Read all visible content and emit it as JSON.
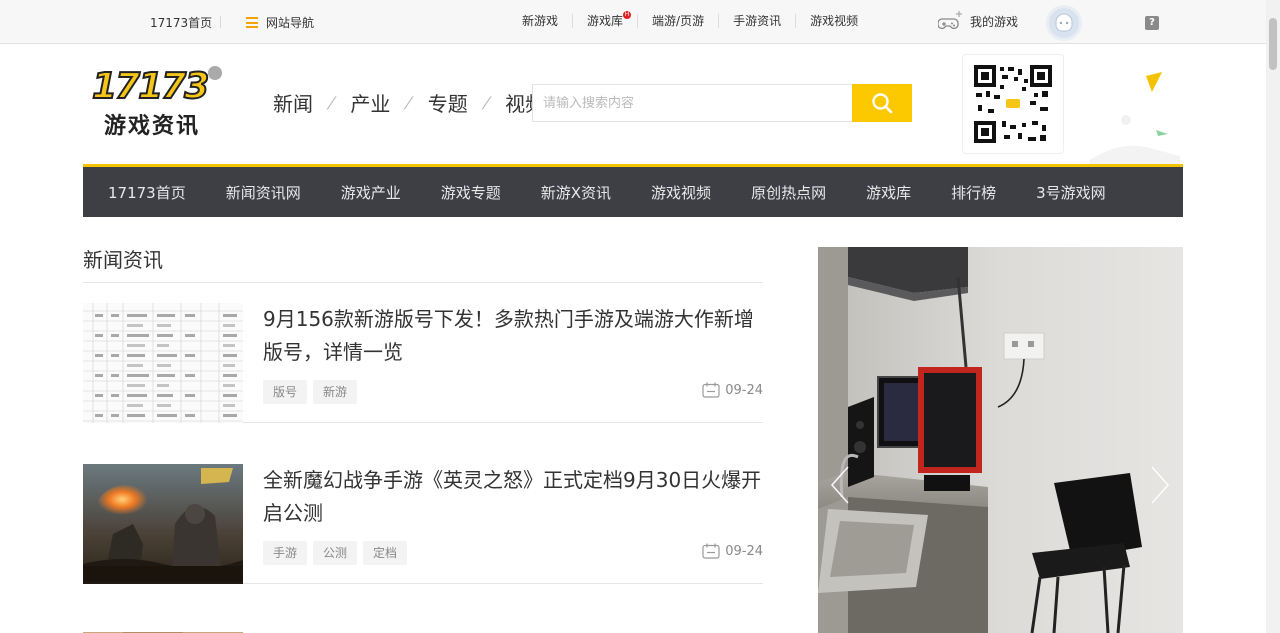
{
  "topbar": {
    "site_label": "17173首页",
    "nav_label": "网站导航",
    "links": [
      {
        "label": "新游戏",
        "hot": false
      },
      {
        "label": "游戏库",
        "hot": true
      },
      {
        "label": "端游/页游",
        "hot": false
      },
      {
        "label": "手游资讯",
        "hot": false
      },
      {
        "label": "游戏视频",
        "hot": false
      }
    ],
    "game_label": "我的游戏",
    "help_icon": "question-icon"
  },
  "header": {
    "logo_number": "17173",
    "logo_text": "游戏资讯",
    "categories": [
      "新闻",
      "产业",
      "专题",
      "视频"
    ],
    "search_placeholder": "请输入搜索内容",
    "search_icon": "search-icon"
  },
  "nav": {
    "items": [
      "17173首页",
      "新闻资讯网",
      "游戏产业",
      "游戏专题",
      "新游X资讯",
      "游戏视频",
      "原创热点网",
      "游戏库",
      "排行榜",
      "3号游戏网"
    ]
  },
  "section": {
    "title": "新闻资讯"
  },
  "articles": [
    {
      "title": "9月156款新游版号下发！多款热门手游及端游大作新增版号，详情一览",
      "tags": [
        "版号",
        "新游"
      ],
      "date": "09-24"
    },
    {
      "title": "全新魔幻战争手游《英灵之怒》正式定档9月30日火爆开启公测",
      "tags": [
        "手游",
        "公测",
        "定档"
      ],
      "date": "09-24"
    }
  ],
  "colors": {
    "accent": "#fcc800",
    "nav_bg": "#3d3f45",
    "topbar_bg": "#f7f7f7"
  }
}
